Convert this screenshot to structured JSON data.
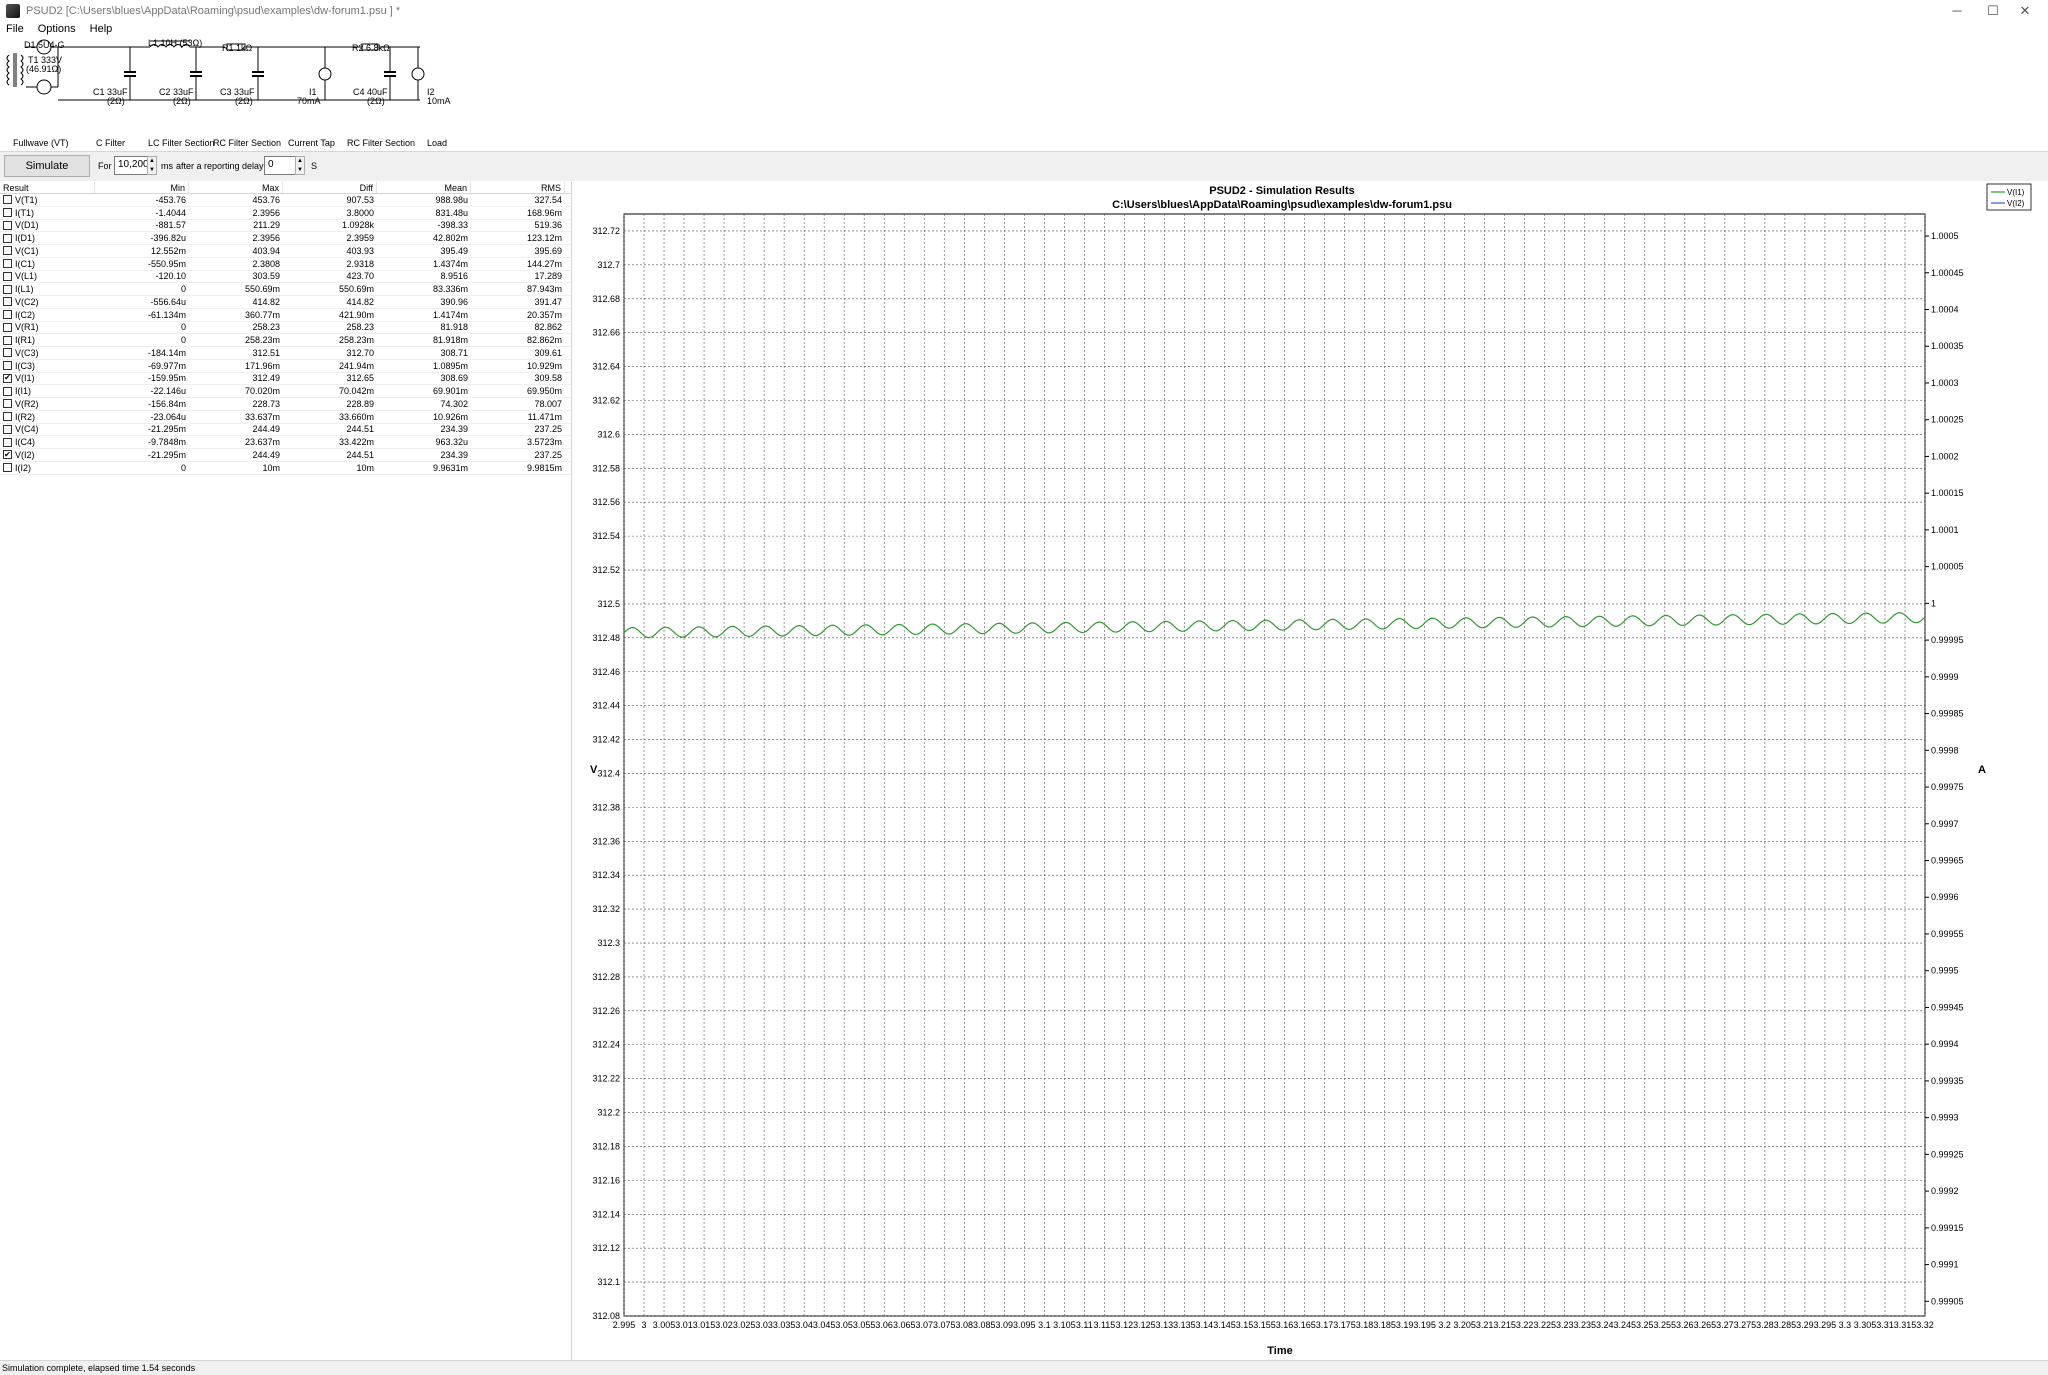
{
  "window": {
    "title": "PSUD2  [C:\\Users\\blues\\AppData\\Roaming\\psud\\examples\\dw-forum1.psu ] *",
    "controls": [
      "─",
      "☐",
      "✕"
    ]
  },
  "menu": [
    "File",
    "Options",
    "Help"
  ],
  "schematic": {
    "d1": "D1 5U4-G",
    "t1_line1": "T1 333V",
    "t1_line2": "(46.91Ω)",
    "l1": "L1 10H (53Ω)",
    "r1": "R1 1kΩ",
    "r2": "R2 6.8kΩ",
    "c1_line1": "C1 33uF",
    "c1_line2": "(2Ω)",
    "c2_line1": "C2 33uF",
    "c2_line2": "(2Ω)",
    "c3_line1": "C3 33uF",
    "c3_line2": "(2Ω)",
    "c4_line1": "C4 40uF",
    "c4_line2": "(2Ω)",
    "i1_line1": "I1",
    "i1_line2": "70mA",
    "i2_line1": "I2",
    "i2_line2": "10mA",
    "sections": [
      "Fullwave (VT)",
      "C Filter",
      "LC Filter Section",
      "RC Filter Section",
      "Current Tap",
      "RC Filter Section",
      "Load"
    ]
  },
  "toolbar": {
    "simulate": "Simulate",
    "for_label": "For",
    "duration": "10,200",
    "ms_label": "ms",
    "after_label": "after a reporting delay of",
    "delay": "0",
    "s_label": "S"
  },
  "results": {
    "headers": [
      "Result",
      "Min",
      "Max",
      "Diff",
      "Mean",
      "RMS"
    ],
    "rows": [
      {
        "name": "V(T1)",
        "checked": false,
        "min": "-453.76",
        "max": "453.76",
        "diff": "907.53",
        "mean": "988.98u",
        "rms": "327.54"
      },
      {
        "name": "I(T1)",
        "checked": false,
        "min": "-1.4044",
        "max": "2.3956",
        "diff": "3.8000",
        "mean": "831.48u",
        "rms": "168.96m"
      },
      {
        "name": "V(D1)",
        "checked": false,
        "min": "-881.57",
        "max": "211.29",
        "diff": "1.0928k",
        "mean": "-398.33",
        "rms": "519.36"
      },
      {
        "name": "I(D1)",
        "checked": false,
        "min": "-396.82u",
        "max": "2.3956",
        "diff": "2.3959",
        "mean": "42.802m",
        "rms": "123.12m"
      },
      {
        "name": "V(C1)",
        "checked": false,
        "min": "12.552m",
        "max": "403.94",
        "diff": "403.93",
        "mean": "395.49",
        "rms": "395.69"
      },
      {
        "name": "I(C1)",
        "checked": false,
        "min": "-550.95m",
        "max": "2.3808",
        "diff": "2.9318",
        "mean": "1.4374m",
        "rms": "144.27m"
      },
      {
        "name": "V(L1)",
        "checked": false,
        "min": "-120.10",
        "max": "303.59",
        "diff": "423.70",
        "mean": "8.9516",
        "rms": "17.289"
      },
      {
        "name": "I(L1)",
        "checked": false,
        "min": "0",
        "max": "550.69m",
        "diff": "550.69m",
        "mean": "83.336m",
        "rms": "87.943m"
      },
      {
        "name": "V(C2)",
        "checked": false,
        "min": "-556.64u",
        "max": "414.82",
        "diff": "414.82",
        "mean": "390.96",
        "rms": "391.47"
      },
      {
        "name": "I(C2)",
        "checked": false,
        "min": "-61.134m",
        "max": "360.77m",
        "diff": "421.90m",
        "mean": "1.4174m",
        "rms": "20.357m"
      },
      {
        "name": "V(R1)",
        "checked": false,
        "min": "0",
        "max": "258.23",
        "diff": "258.23",
        "mean": "81.918",
        "rms": "82.862"
      },
      {
        "name": "I(R1)",
        "checked": false,
        "min": "0",
        "max": "258.23m",
        "diff": "258.23m",
        "mean": "81.918m",
        "rms": "82.862m"
      },
      {
        "name": "V(C3)",
        "checked": false,
        "min": "-184.14m",
        "max": "312.51",
        "diff": "312.70",
        "mean": "308.71",
        "rms": "309.61"
      },
      {
        "name": "I(C3)",
        "checked": false,
        "min": "-69.977m",
        "max": "171.96m",
        "diff": "241.94m",
        "mean": "1.0895m",
        "rms": "10.929m"
      },
      {
        "name": "V(I1)",
        "checked": true,
        "min": "-159.95m",
        "max": "312.49",
        "diff": "312.65",
        "mean": "308.69",
        "rms": "309.58"
      },
      {
        "name": "I(I1)",
        "checked": false,
        "min": "-22.146u",
        "max": "70.020m",
        "diff": "70.042m",
        "mean": "69.901m",
        "rms": "69.950m"
      },
      {
        "name": "V(R2)",
        "checked": false,
        "min": "-156.84m",
        "max": "228.73",
        "diff": "228.89",
        "mean": "74.302",
        "rms": "78.007"
      },
      {
        "name": "I(R2)",
        "checked": false,
        "min": "-23.064u",
        "max": "33.637m",
        "diff": "33.660m",
        "mean": "10.926m",
        "rms": "11.471m"
      },
      {
        "name": "V(C4)",
        "checked": false,
        "min": "-21.295m",
        "max": "244.49",
        "diff": "244.51",
        "mean": "234.39",
        "rms": "237.25"
      },
      {
        "name": "I(C4)",
        "checked": false,
        "min": "-9.7848m",
        "max": "23.637m",
        "diff": "33.422m",
        "mean": "963.32u",
        "rms": "3.5723m"
      },
      {
        "name": "V(I2)",
        "checked": true,
        "min": "-21.295m",
        "max": "244.49",
        "diff": "244.51",
        "mean": "234.39",
        "rms": "237.25"
      },
      {
        "name": "I(I2)",
        "checked": false,
        "min": "0",
        "max": "10m",
        "diff": "10m",
        "mean": "9.9631m",
        "rms": "9.9815m"
      }
    ]
  },
  "chart_data": {
    "type": "line",
    "title": "PSUD2 - Simulation Results",
    "subtitle": "C:\\Users\\blues\\AppData\\Roaming\\psud\\examples\\dw-forum1.psu",
    "xlabel": "Time",
    "ylabel": "V",
    "y2label": "A",
    "xlim": [
      2.995,
      3.32
    ],
    "ylim": [
      312.08,
      312.73
    ],
    "y2lim": [
      0.99903,
      1.00053
    ],
    "grid": true,
    "legend_position": "top-right",
    "x_ticks": [
      "2.995",
      "3",
      "3.005",
      "3.01",
      "3.015",
      "3.02",
      "3.025",
      "3.03",
      "3.035",
      "3.04",
      "3.045",
      "3.05",
      "3.055",
      "3.06",
      "3.065",
      "3.07",
      "3.075",
      "3.08",
      "3.085",
      "3.09",
      "3.095",
      "3.1",
      "3.105",
      "3.11",
      "3.115",
      "3.12",
      "3.125",
      "3.13",
      "3.135",
      "3.14",
      "3.145",
      "3.15",
      "3.155",
      "3.16",
      "3.165",
      "3.17",
      "3.175",
      "3.18",
      "3.185",
      "3.19",
      "3.195",
      "3.2",
      "3.205",
      "3.21",
      "3.215",
      "3.22",
      "3.225",
      "3.23",
      "3.235",
      "3.24",
      "3.245",
      "3.25",
      "3.255",
      "3.26",
      "3.265",
      "3.27",
      "3.275",
      "3.28",
      "3.285",
      "3.29",
      "3.295",
      "3.3",
      "3.305",
      "3.31",
      "3.315",
      "3.32"
    ],
    "y_ticks": [
      "312.72",
      "312.7",
      "312.68",
      "312.66",
      "312.64",
      "312.62",
      "312.6",
      "312.58",
      "312.56",
      "312.54",
      "312.52",
      "312.5",
      "312.48",
      "312.46",
      "312.44",
      "312.42",
      "312.4",
      "312.38",
      "312.36",
      "312.34",
      "312.32",
      "312.3",
      "312.28",
      "312.26",
      "312.24",
      "312.22",
      "312.2",
      "312.18",
      "312.16",
      "312.14",
      "312.12",
      "312.1",
      "312.08"
    ],
    "y2_ticks": [
      "1.0005",
      "1.00045",
      "1.0004",
      "1.00035",
      "1.0003",
      "1.00025",
      "1.0002",
      "1.00015",
      "1.0001",
      "1.00005",
      "1",
      "0.99995",
      "0.9999",
      "0.99985",
      "0.9998",
      "0.99975",
      "0.9997",
      "0.99965",
      "0.9996",
      "0.99955",
      "0.9995",
      "0.99945",
      "0.9994",
      "0.99935",
      "0.9993",
      "0.99925",
      "0.9992",
      "0.99915",
      "0.9991",
      "0.99905"
    ],
    "series": [
      {
        "name": "V(I1)",
        "color": "#2e9a2e",
        "axis": "left",
        "baseline_start": 312.483,
        "baseline_end": 312.492,
        "ripple_amplitude": 0.003,
        "ripple_period": 0.00833
      },
      {
        "name": "V(I2)",
        "color": "#4a4ad0",
        "axis": "left",
        "visible_in_range": false
      }
    ]
  },
  "status": "Simulation complete, elapsed time 1.54 seconds"
}
